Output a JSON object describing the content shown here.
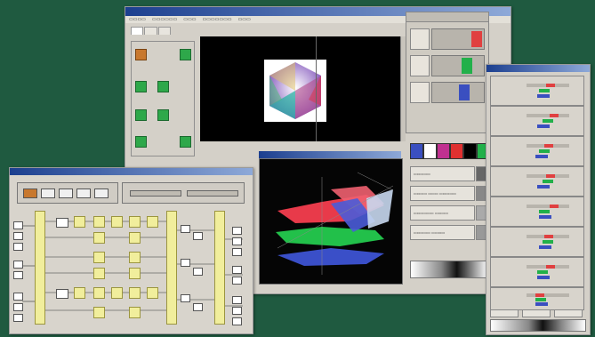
{
  "colors": {
    "desktop": "#1f5a40",
    "window_bg": "#d4d0c8",
    "titlebar": "#1c3f8f",
    "accent_green": "#2ea84a",
    "accent_orange": "#c8782e",
    "highlight_yellow": "#f1ee9c",
    "red": "#e04040",
    "green": "#22b04a",
    "blue": "#3a4fc0"
  },
  "main_window": {
    "tabs": [
      "",
      "",
      ""
    ],
    "rgb_sliders": [
      {
        "channel": "red",
        "level": 0.8
      },
      {
        "channel": "green",
        "level": 0.55
      },
      {
        "channel": "blue",
        "level": 0.5
      }
    ],
    "swatches": [
      "blue",
      "white",
      "magenta",
      "red",
      "black",
      "green"
    ]
  },
  "right_panel": {
    "channels": [
      {
        "levels": [
          0.75,
          0.55,
          0.4
        ]
      },
      {
        "levels": [
          0.8,
          0.6,
          0.45
        ]
      },
      {
        "levels": [
          0.7,
          0.5,
          0.4
        ]
      },
      {
        "levels": [
          0.75,
          0.6,
          0.45
        ]
      },
      {
        "levels": [
          0.8,
          0.55,
          0.5
        ]
      },
      {
        "levels": [
          0.7,
          0.6,
          0.5
        ]
      },
      {
        "levels": [
          0.75,
          0.5,
          0.45
        ]
      },
      {
        "levels": [
          0.8,
          0.6,
          0.5
        ]
      }
    ]
  },
  "icons": [
    "color-cube-icon",
    "surface-plot-icon",
    "gradient-bar-icon"
  ]
}
